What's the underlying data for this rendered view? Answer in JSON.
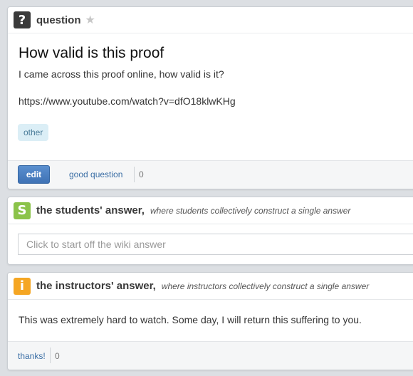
{
  "question": {
    "header_label": "question",
    "badge_glyph": "?",
    "title": "How valid is this proof",
    "body": "I came across this proof online, how valid is it?",
    "link": "https://www.youtube.com/watch?v=dfO18klwKHg",
    "tag": "other",
    "edit_label": "edit",
    "good_question_label": "good question",
    "good_question_count": "0"
  },
  "students_answer": {
    "badge_glyph": "S",
    "title": "the students' answer,",
    "subtitle": "where students collectively construct a single answer",
    "placeholder": "Click to start off the wiki answer"
  },
  "instructors_answer": {
    "badge_glyph": "i",
    "title": "the instructors' answer,",
    "subtitle": "where instructors collectively construct a single answer",
    "body": "This was extremely hard to watch. Some day, I will return this suffering to you.",
    "thanks_label": "thanks!",
    "thanks_count": "0"
  },
  "colors": {
    "question_badge": "#3a3a3a",
    "students_badge": "#8bc34a",
    "instructors_badge": "#f5a623",
    "edit_button": "#4a7fc1"
  }
}
